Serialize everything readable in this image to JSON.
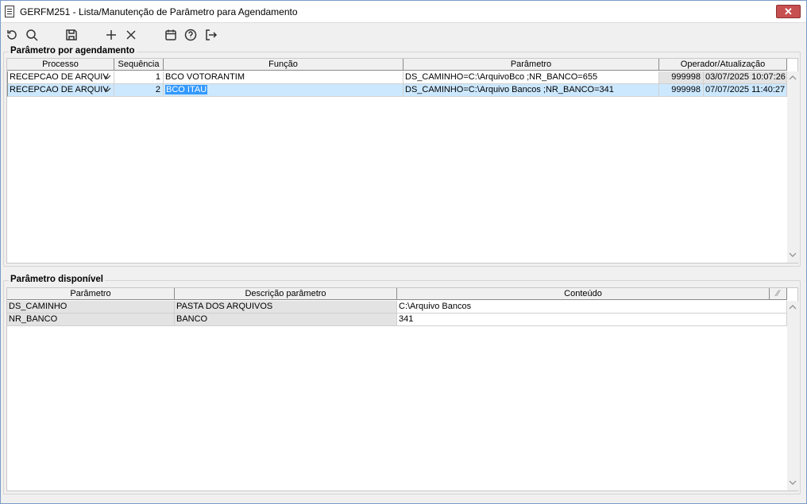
{
  "window": {
    "title": "GERFM251 - Lista/Manutenção de Parâmetro para Agendamento",
    "close_glyph": "✕"
  },
  "toolbar": {
    "buttons": [
      {
        "name": "refresh-icon"
      },
      {
        "name": "search-icon"
      },
      {
        "name": "save-icon"
      },
      {
        "name": "add-icon"
      },
      {
        "name": "delete-icon"
      },
      {
        "name": "calendar-icon"
      },
      {
        "name": "help-icon"
      },
      {
        "name": "exit-icon"
      }
    ]
  },
  "schedule_params": {
    "group_title": "Parâmetro por agendamento",
    "columns": [
      "Processo",
      "Sequência",
      "Função",
      "Parâmetro",
      "Operador/Atualização"
    ],
    "rows": [
      {
        "processo": "RECEPCAO DE ARQUIV",
        "sequencia": "1",
        "funcao": "BCO VOTORANTIM",
        "parametro": "DS_CAMINHO=C:\\ArquivoBco ;NR_BANCO=655",
        "operador": "999998",
        "atualizacao": "03/07/2025 10:07:26",
        "selected": false
      },
      {
        "processo": "RECEPCAO DE ARQUIV",
        "sequencia": "2",
        "funcao": "BCO ITAU",
        "parametro": "DS_CAMINHO=C:\\Arquivo Bancos ;NR_BANCO=341",
        "operador": "999998",
        "atualizacao": "07/07/2025 11:40:27",
        "selected": true
      }
    ]
  },
  "available_params": {
    "group_title": "Parâmetro disponível",
    "columns": [
      "Parâmetro",
      "Descrição parâmetro",
      "Conteúdo"
    ],
    "rows": [
      {
        "parametro": "DS_CAMINHO",
        "descricao": "PASTA DOS ARQUIVOS",
        "conteudo": "C:\\Arquivo Bancos"
      },
      {
        "parametro": "NR_BANCO",
        "descricao": "BANCO",
        "conteudo": "341"
      }
    ]
  },
  "colors": {
    "selected_row": "#cce8ff",
    "text_highlight": "#3399ff",
    "close_button": "#c75050"
  }
}
